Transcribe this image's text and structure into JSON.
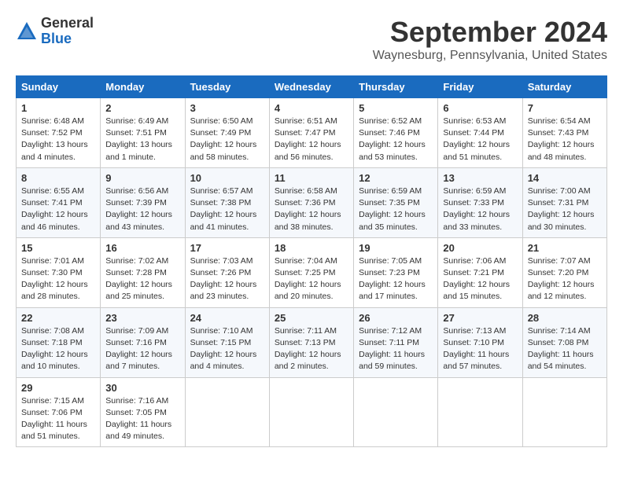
{
  "header": {
    "logo_general": "General",
    "logo_blue": "Blue",
    "month_title": "September 2024",
    "location": "Waynesburg, Pennsylvania, United States"
  },
  "days_of_week": [
    "Sunday",
    "Monday",
    "Tuesday",
    "Wednesday",
    "Thursday",
    "Friday",
    "Saturday"
  ],
  "weeks": [
    [
      {
        "day": "1",
        "info": "Sunrise: 6:48 AM\nSunset: 7:52 PM\nDaylight: 13 hours\nand 4 minutes."
      },
      {
        "day": "2",
        "info": "Sunrise: 6:49 AM\nSunset: 7:51 PM\nDaylight: 13 hours\nand 1 minute."
      },
      {
        "day": "3",
        "info": "Sunrise: 6:50 AM\nSunset: 7:49 PM\nDaylight: 12 hours\nand 58 minutes."
      },
      {
        "day": "4",
        "info": "Sunrise: 6:51 AM\nSunset: 7:47 PM\nDaylight: 12 hours\nand 56 minutes."
      },
      {
        "day": "5",
        "info": "Sunrise: 6:52 AM\nSunset: 7:46 PM\nDaylight: 12 hours\nand 53 minutes."
      },
      {
        "day": "6",
        "info": "Sunrise: 6:53 AM\nSunset: 7:44 PM\nDaylight: 12 hours\nand 51 minutes."
      },
      {
        "day": "7",
        "info": "Sunrise: 6:54 AM\nSunset: 7:43 PM\nDaylight: 12 hours\nand 48 minutes."
      }
    ],
    [
      {
        "day": "8",
        "info": "Sunrise: 6:55 AM\nSunset: 7:41 PM\nDaylight: 12 hours\nand 46 minutes."
      },
      {
        "day": "9",
        "info": "Sunrise: 6:56 AM\nSunset: 7:39 PM\nDaylight: 12 hours\nand 43 minutes."
      },
      {
        "day": "10",
        "info": "Sunrise: 6:57 AM\nSunset: 7:38 PM\nDaylight: 12 hours\nand 41 minutes."
      },
      {
        "day": "11",
        "info": "Sunrise: 6:58 AM\nSunset: 7:36 PM\nDaylight: 12 hours\nand 38 minutes."
      },
      {
        "day": "12",
        "info": "Sunrise: 6:59 AM\nSunset: 7:35 PM\nDaylight: 12 hours\nand 35 minutes."
      },
      {
        "day": "13",
        "info": "Sunrise: 6:59 AM\nSunset: 7:33 PM\nDaylight: 12 hours\nand 33 minutes."
      },
      {
        "day": "14",
        "info": "Sunrise: 7:00 AM\nSunset: 7:31 PM\nDaylight: 12 hours\nand 30 minutes."
      }
    ],
    [
      {
        "day": "15",
        "info": "Sunrise: 7:01 AM\nSunset: 7:30 PM\nDaylight: 12 hours\nand 28 minutes."
      },
      {
        "day": "16",
        "info": "Sunrise: 7:02 AM\nSunset: 7:28 PM\nDaylight: 12 hours\nand 25 minutes."
      },
      {
        "day": "17",
        "info": "Sunrise: 7:03 AM\nSunset: 7:26 PM\nDaylight: 12 hours\nand 23 minutes."
      },
      {
        "day": "18",
        "info": "Sunrise: 7:04 AM\nSunset: 7:25 PM\nDaylight: 12 hours\nand 20 minutes."
      },
      {
        "day": "19",
        "info": "Sunrise: 7:05 AM\nSunset: 7:23 PM\nDaylight: 12 hours\nand 17 minutes."
      },
      {
        "day": "20",
        "info": "Sunrise: 7:06 AM\nSunset: 7:21 PM\nDaylight: 12 hours\nand 15 minutes."
      },
      {
        "day": "21",
        "info": "Sunrise: 7:07 AM\nSunset: 7:20 PM\nDaylight: 12 hours\nand 12 minutes."
      }
    ],
    [
      {
        "day": "22",
        "info": "Sunrise: 7:08 AM\nSunset: 7:18 PM\nDaylight: 12 hours\nand 10 minutes."
      },
      {
        "day": "23",
        "info": "Sunrise: 7:09 AM\nSunset: 7:16 PM\nDaylight: 12 hours\nand 7 minutes."
      },
      {
        "day": "24",
        "info": "Sunrise: 7:10 AM\nSunset: 7:15 PM\nDaylight: 12 hours\nand 4 minutes."
      },
      {
        "day": "25",
        "info": "Sunrise: 7:11 AM\nSunset: 7:13 PM\nDaylight: 12 hours\nand 2 minutes."
      },
      {
        "day": "26",
        "info": "Sunrise: 7:12 AM\nSunset: 7:11 PM\nDaylight: 11 hours\nand 59 minutes."
      },
      {
        "day": "27",
        "info": "Sunrise: 7:13 AM\nSunset: 7:10 PM\nDaylight: 11 hours\nand 57 minutes."
      },
      {
        "day": "28",
        "info": "Sunrise: 7:14 AM\nSunset: 7:08 PM\nDaylight: 11 hours\nand 54 minutes."
      }
    ],
    [
      {
        "day": "29",
        "info": "Sunrise: 7:15 AM\nSunset: 7:06 PM\nDaylight: 11 hours\nand 51 minutes."
      },
      {
        "day": "30",
        "info": "Sunrise: 7:16 AM\nSunset: 7:05 PM\nDaylight: 11 hours\nand 49 minutes."
      },
      null,
      null,
      null,
      null,
      null
    ]
  ]
}
